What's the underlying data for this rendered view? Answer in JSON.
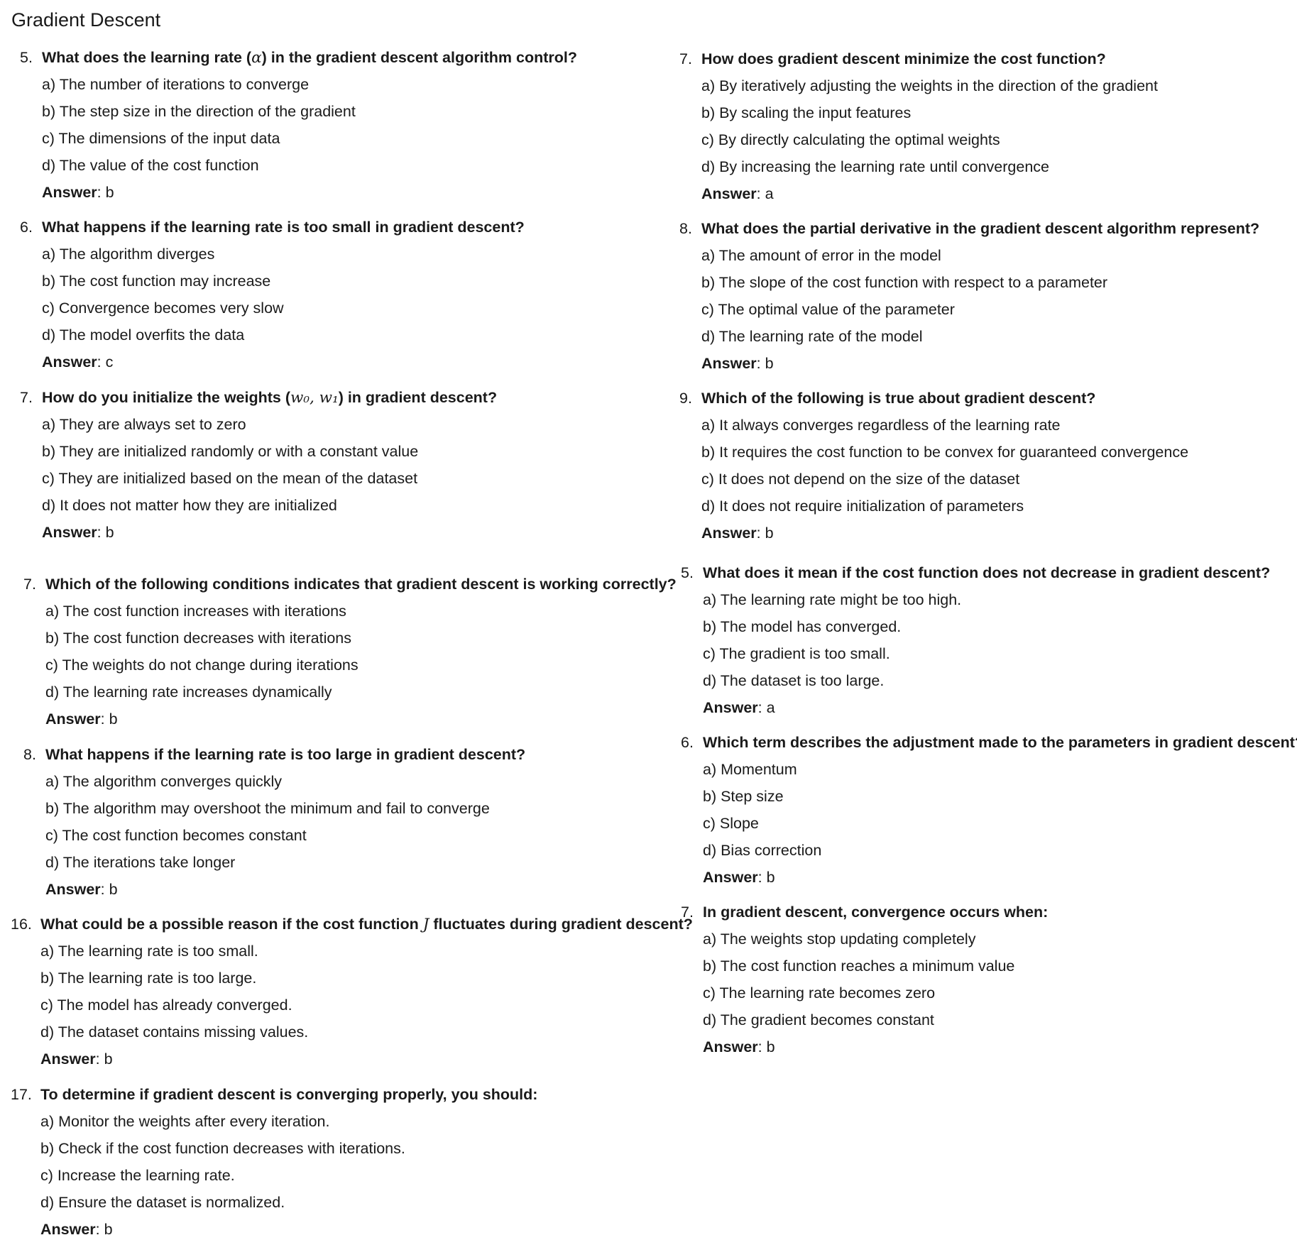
{
  "title": "Gradient Descent",
  "left_column": [
    {
      "number": "5.",
      "question_pre": "What does the learning rate (",
      "question_math": "α",
      "question_post": ") in the gradient descent algorithm control?",
      "options": [
        "a) The number of iterations to converge",
        "b) The step size in the direction of the gradient",
        "c) The dimensions of the input data",
        "d) The value of the cost function"
      ],
      "answer_label": "Answer",
      "answer_value": ": b"
    },
    {
      "number": "6.",
      "question_pre": "What happens if the learning rate is too small in gradient descent?",
      "question_math": "",
      "question_post": "",
      "options": [
        "a) The algorithm diverges",
        "b) The cost function may increase",
        "c) Convergence becomes very slow",
        "d) The model overfits the data"
      ],
      "answer_label": "Answer",
      "answer_value": ": c"
    },
    {
      "number": "7.",
      "question_pre": "How do you initialize the weights (",
      "question_math": "w₀, w₁",
      "question_post": ") in gradient descent?",
      "options": [
        "a) They are always set to zero",
        "b) They are initialized randomly or with a constant value",
        "c) They are initialized based on the mean of the dataset",
        "d) It does not matter how they are initialized"
      ],
      "answer_label": "Answer",
      "answer_value": ": b"
    },
    {
      "number": "7.",
      "question_pre": "Which of the following conditions indicates that gradient descent is working correctly?",
      "question_math": "",
      "question_post": "",
      "options": [
        "a) The cost function increases with iterations",
        "b) The cost function decreases with iterations",
        "c) The weights do not change during iterations",
        "d) The learning rate increases dynamically"
      ],
      "answer_label": "Answer",
      "answer_value": ": b"
    },
    {
      "number": "8.",
      "question_pre": "What happens if the learning rate is too large in gradient descent?",
      "question_math": "",
      "question_post": "",
      "options": [
        "a) The algorithm converges quickly",
        "b) The algorithm may overshoot the minimum and fail to converge",
        "c) The cost function becomes constant",
        "d) The iterations take longer"
      ],
      "answer_label": "Answer",
      "answer_value": ": b"
    },
    {
      "number": "16.",
      "question_pre": "What could be a possible reason if the cost function ",
      "question_math": "J",
      "question_post": " fluctuates during gradient descent?",
      "options": [
        "a) The learning rate is too small.",
        "b) The learning rate is too large.",
        "c) The model has already converged.",
        "d) The dataset contains missing values."
      ],
      "answer_label": "Answer",
      "answer_value": ": b"
    },
    {
      "number": "17.",
      "question_pre": "To determine if gradient descent is converging properly, you should:",
      "question_math": "",
      "question_post": "",
      "options": [
        "a) Monitor the weights after every iteration.",
        "b) Check if the cost function decreases with iterations.",
        "c) Increase the learning rate.",
        "d) Ensure the dataset is normalized."
      ],
      "answer_label": "Answer",
      "answer_value": ": b"
    }
  ],
  "right_column": [
    {
      "number": "7.",
      "question_pre": "How does gradient descent minimize the cost function?",
      "question_math": "",
      "question_post": "",
      "options": [
        "a) By iteratively adjusting the weights in the direction of the gradient",
        "b) By scaling the input features",
        "c) By directly calculating the optimal weights",
        "d) By increasing the learning rate until convergence"
      ],
      "answer_label": "Answer",
      "answer_value": ": a"
    },
    {
      "number": "8.",
      "question_pre": "What does the partial derivative in the gradient descent algorithm represent?",
      "question_math": "",
      "question_post": "",
      "options": [
        "a) The amount of error in the model",
        "b) The slope of the cost function with respect to a parameter",
        "c) The optimal value of the parameter",
        "d) The learning rate of the model"
      ],
      "answer_label": "Answer",
      "answer_value": ": b"
    },
    {
      "number": "9.",
      "question_pre": "Which of the following is true about gradient descent?",
      "question_math": "",
      "question_post": "",
      "options": [
        "a) It always converges regardless of the learning rate",
        "b) It requires the cost function to be convex for guaranteed convergence",
        "c) It does not depend on the size of the dataset",
        "d) It does not require initialization of parameters"
      ],
      "answer_label": "Answer",
      "answer_value": ": b"
    },
    {
      "number": "5.",
      "question_pre": "What does it mean if the cost function does not decrease in gradient descent?",
      "question_math": "",
      "question_post": "",
      "options": [
        "a) The learning rate might be too high.",
        "b) The model has converged.",
        "c) The gradient is too small.",
        "d) The dataset is too large."
      ],
      "answer_label": "Answer",
      "answer_value": ": a"
    },
    {
      "number": "6.",
      "question_pre": "Which term describes the adjustment made to the parameters in gradient descent?",
      "question_math": "",
      "question_post": "",
      "options": [
        "a) Momentum",
        "b) Step size",
        "c) Slope",
        "d) Bias correction"
      ],
      "answer_label": "Answer",
      "answer_value": ": b"
    },
    {
      "number": "7.",
      "question_pre": "In gradient descent, convergence occurs when:",
      "question_math": "",
      "question_post": "",
      "options": [
        "a) The weights stop updating completely",
        "b) The cost function reaches a minimum value",
        "c) The learning rate becomes zero",
        "d) The gradient becomes constant"
      ],
      "answer_label": "Answer",
      "answer_value": ": b"
    }
  ]
}
